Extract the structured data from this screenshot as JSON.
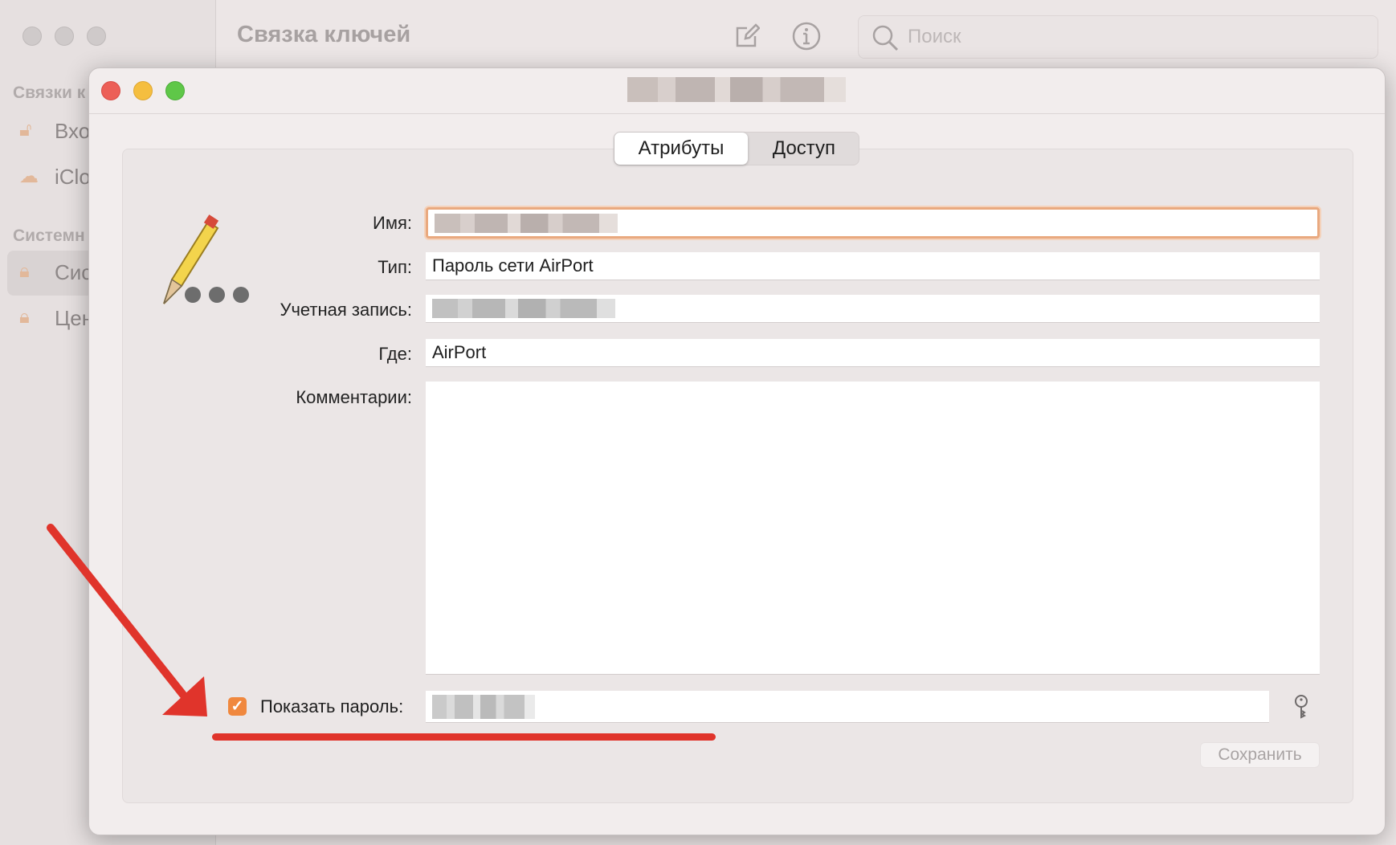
{
  "app": {
    "title": "Связка ключей",
    "search_placeholder": "Поиск",
    "sidebar": {
      "section_keychains": "Связки к",
      "items_top": [
        "Вхо",
        "iClo"
      ],
      "section_system": "Системн",
      "items_system": [
        "Сис",
        "Цен"
      ]
    }
  },
  "dialog": {
    "tabs": [
      "Атрибуты",
      "Доступ"
    ],
    "active_tab": "Атрибуты",
    "fields": {
      "name_label": "Имя:",
      "type_label": "Тип:",
      "type_value": "Пароль сети AirPort",
      "account_label": "Учетная запись:",
      "where_label": "Где:",
      "where_value": "AirPort",
      "comments_label": "Комментарии:",
      "comments_value": ""
    },
    "show_password_label": "Показать пароль:",
    "show_password_checked": true,
    "save_label": "Сохранить"
  },
  "colors": {
    "accent": "#f0883e",
    "annotation": "#e0342b"
  }
}
